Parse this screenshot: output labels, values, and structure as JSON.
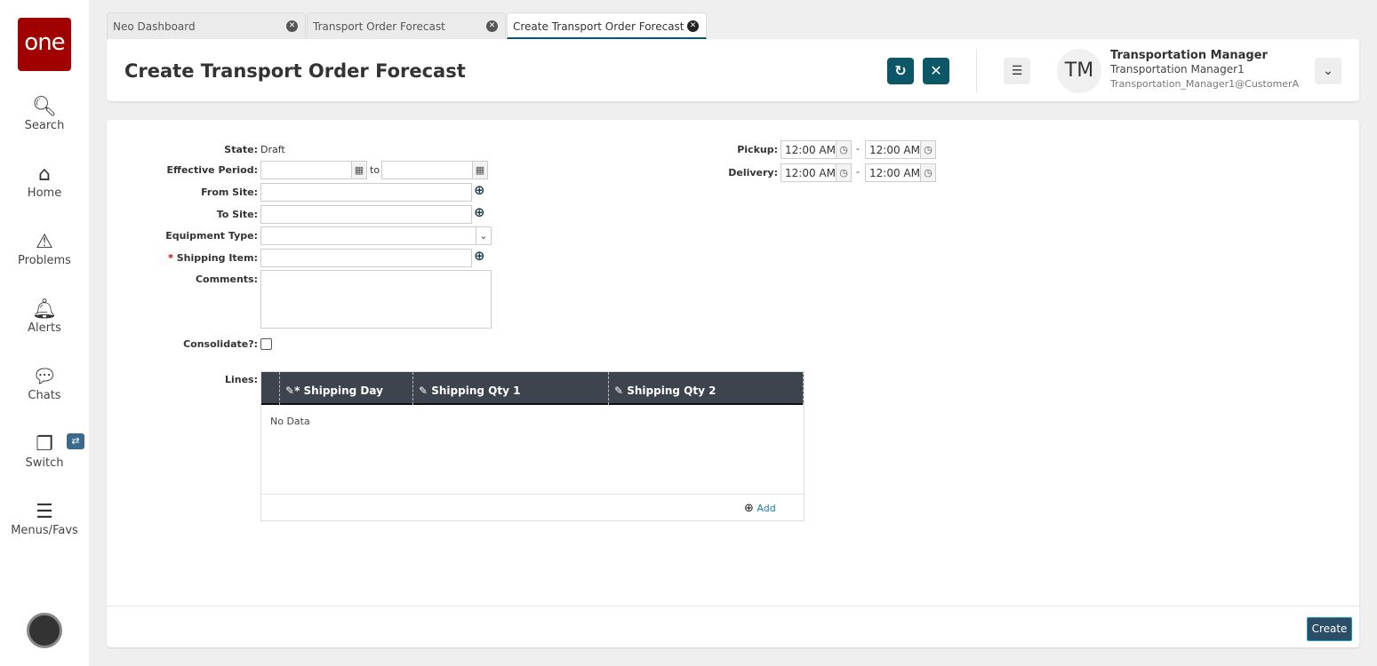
{
  "sidebar": {
    "logo": "one",
    "items": [
      {
        "label": "Search",
        "icon": "search-icon"
      },
      {
        "label": "Home",
        "icon": "home-icon"
      },
      {
        "label": "Problems",
        "icon": "warning-icon"
      },
      {
        "label": "Alerts",
        "icon": "bell-icon"
      },
      {
        "label": "Chats",
        "icon": "chat-icon"
      },
      {
        "label": "Switch",
        "icon": "switch-icon"
      },
      {
        "label": "Menus/Favs",
        "icon": "menu-icon"
      }
    ]
  },
  "tabs": [
    {
      "label": "Neo Dashboard"
    },
    {
      "label": "Transport Order Forecast"
    },
    {
      "label": "Create Transport Order Forecast",
      "active": true
    }
  ],
  "header": {
    "title": "Create Transport Order Forecast",
    "user": {
      "initials": "TM",
      "role": "Transportation Manager",
      "name": "Transportation Manager1",
      "email": "Transportation_Manager1@CustomerA"
    }
  },
  "form": {
    "state_label": "State:",
    "state_value": "Draft",
    "effective_period_label": "Effective Period:",
    "to_label": "to",
    "from_site_label": "From Site:",
    "to_site_label": "To Site:",
    "equipment_type_label": "Equipment Type:",
    "required_mark": "*",
    "shipping_item_label": "Shipping Item:",
    "comments_label": "Comments:",
    "consolidate_label": "Consolidate?:",
    "pickup_label": "Pickup:",
    "pickup_from": "12:00 AM",
    "pickup_to": "12:00 AM",
    "delivery_label": "Delivery:",
    "delivery_from": "12:00 AM",
    "delivery_to": "12:00 AM",
    "dash": "-",
    "lines_label": "Lines:",
    "lines": {
      "columns": [
        {
          "label": "Shipping Day",
          "required": "*"
        },
        {
          "label": "Shipping Qty 1"
        },
        {
          "label": "Shipping Qty 2"
        }
      ],
      "empty": "No Data",
      "add_label": "Add"
    }
  },
  "footer": {
    "create_label": "Create"
  },
  "colors": {
    "accent": "#0b5768",
    "logo": "#a00000",
    "grid_header": "#3d444d"
  }
}
